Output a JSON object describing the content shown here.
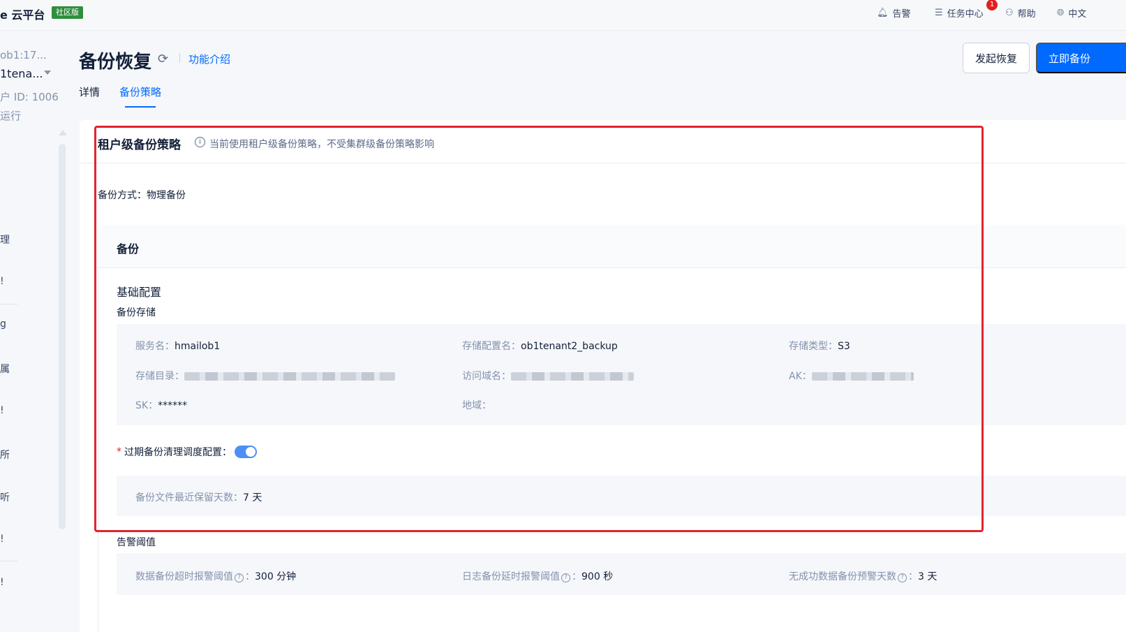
{
  "topbar": {
    "brand": "e 云平台",
    "edition": "社区版",
    "alerts_label": "告警",
    "tasks_label": "任务中心",
    "tasks_badge": "1",
    "help_label": "帮助",
    "language_label": "中文"
  },
  "sidebar": {
    "cluster": "ob1:17...",
    "tenant": "1tena...",
    "tenant_id": "户 ID: 1006",
    "status": "运行",
    "nav_items": [
      "理",
      "!",
      "g",
      "属",
      "!",
      "所",
      "听",
      "!",
      "!"
    ]
  },
  "header": {
    "title": "备份恢复",
    "feature_link": "功能介绍",
    "restore_button": "发起恢复",
    "backup_button": "立即备份",
    "tabs": [
      {
        "label": "详情",
        "active": false
      },
      {
        "label": "备份策略",
        "active": true
      }
    ]
  },
  "policy": {
    "title": "租户级备份策略",
    "note": "当前使用租户级备份策略，不受集群级备份策略影响",
    "method": "备份方式：物理备份",
    "backup_section": "备份",
    "basic_config": "基础配置",
    "storage_title": "备份存储",
    "storage": {
      "service_label": "服务名：",
      "service_value": "hmailob1",
      "config_label": "存储配置名：",
      "config_value": "ob1tenant2_backup",
      "type_label": "存储类型：",
      "type_value": "S3",
      "dir_label": "存储目录：",
      "domain_label": "访问域名：",
      "ak_label": "AK：",
      "sk_label": "SK：",
      "sk_value": "******",
      "region_label": "地域："
    },
    "cleanup_label": "过期备份清理调度配置：",
    "cleanup_enabled": true,
    "retention_label": "备份文件最近保留天数：",
    "retention_value": "7 天",
    "alert_title": "告警阈值",
    "thresholds": {
      "data_timeout_label": "数据备份超时报警阈值",
      "data_timeout_value": "300 分钟",
      "log_delay_label": "日志备份延时报警阈值",
      "log_delay_value": "900 秒",
      "no_success_label": "无成功数据备份预警天数",
      "no_success_value": "3 天"
    }
  },
  "colors": {
    "primary": "#006aff",
    "highlight": "#e0242e",
    "badge": "#2f8f3d"
  }
}
